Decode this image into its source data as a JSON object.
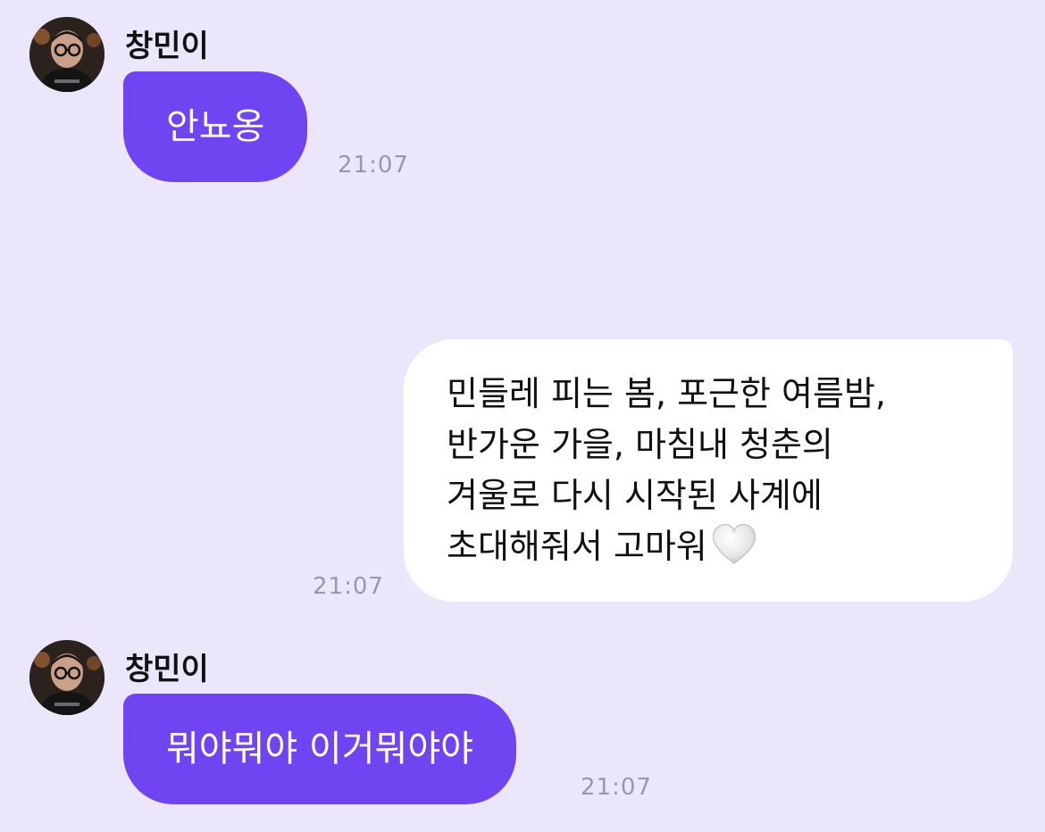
{
  "theme": {
    "background": "#ece6fb",
    "incoming_bubble": "#7044f0",
    "outgoing_bubble": "#ffffff",
    "timestamp_color": "#9a98a6"
  },
  "messages": [
    {
      "direction": "incoming",
      "sender": "창민이",
      "avatar_icon": "profile-photo",
      "text": "안뇨옹",
      "time": "21:07"
    },
    {
      "direction": "outgoing",
      "lines": [
        "민들레 피는 봄, 포근한 여름밤,",
        "반가운 가을, 마침내 청춘의",
        "겨울로 다시 시작된 사계에",
        "초대해줘서 고마워"
      ],
      "emoji_icon": "white-heart-icon",
      "time": "21:07"
    },
    {
      "direction": "incoming",
      "sender": "창민이",
      "avatar_icon": "profile-photo",
      "text": "뭐야뭐야 이거뭐야야",
      "time": "21:07"
    }
  ]
}
